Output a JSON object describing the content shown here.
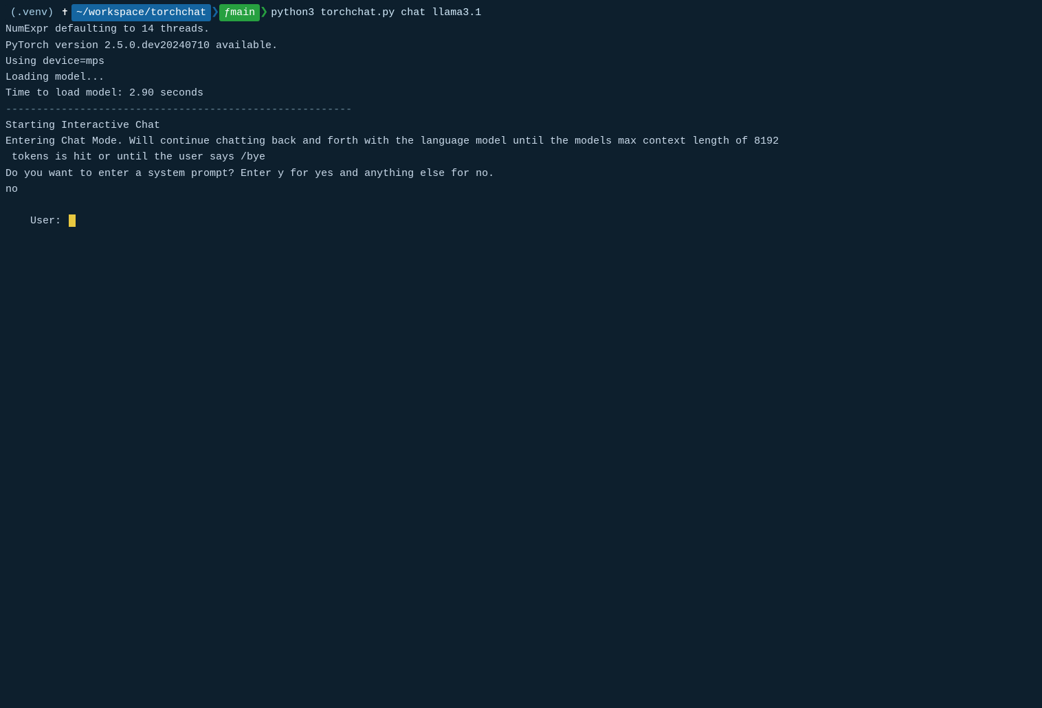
{
  "terminal": {
    "background": "#0d1f2d",
    "header": {
      "venv": "(.venv)",
      "cross": "✝",
      "dir_badge": "~/workspace/torchchat",
      "branch_badge": "main",
      "branch_icon": "ƒ",
      "command": "python3 torchchat.py chat llama3.1"
    },
    "lines": [
      {
        "id": "line1",
        "text": "NumExpr defaulting to 14 threads."
      },
      {
        "id": "line2",
        "text": "PyTorch version 2.5.0.dev20240710 available."
      },
      {
        "id": "line3",
        "text": "Using device=mps"
      },
      {
        "id": "line4",
        "text": "Loading model..."
      },
      {
        "id": "line5",
        "text": "Time to load model: 2.90 seconds"
      },
      {
        "id": "line6",
        "text": "--------------------------------------------------------",
        "type": "separator"
      },
      {
        "id": "line7",
        "text": "Starting Interactive Chat",
        "type": "section-title"
      },
      {
        "id": "line8",
        "text": "Entering Chat Mode. Will continue chatting back and forth with the language model until the models max context length of 8192"
      },
      {
        "id": "line9",
        "text": " tokens is hit or until the user says /bye"
      },
      {
        "id": "line10",
        "text": "Do you want to enter a system prompt? Enter y for yes and anything else for no."
      },
      {
        "id": "line11",
        "text": "no"
      },
      {
        "id": "line12",
        "text": "User: ",
        "type": "user-prompt"
      }
    ]
  }
}
